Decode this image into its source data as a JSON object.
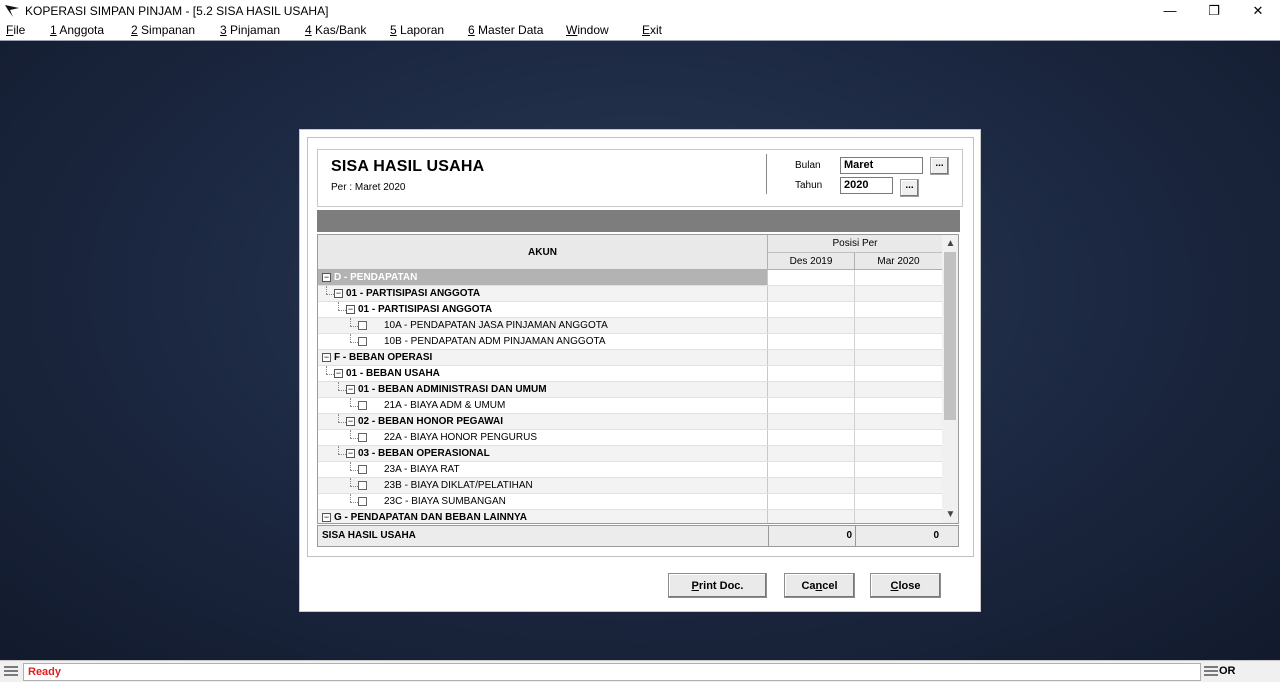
{
  "window": {
    "title": "KOPERASI SIMPAN PINJAM - [5.2 SISA HASIL USAHA]",
    "minimize": "—",
    "restore": "❐",
    "close": "✕"
  },
  "menu": [
    {
      "key": "F",
      "rest": "ile"
    },
    {
      "key": "1",
      "rest": " Anggota"
    },
    {
      "key": "2",
      "rest": " Simpanan"
    },
    {
      "key": "3",
      "rest": " Pinjaman"
    },
    {
      "key": "4",
      "rest": " Kas/Bank"
    },
    {
      "key": "5",
      "rest": " Laporan"
    },
    {
      "key": "6",
      "rest": " Master Data"
    },
    {
      "key": "W",
      "rest": "indow"
    },
    {
      "key": "E",
      "rest": "xit"
    }
  ],
  "report": {
    "title": "SISA HASIL USAHA",
    "subtitle": "Per : Maret 2020",
    "bulan_label": "Bulan",
    "bulan_value": "Maret",
    "tahun_label": "Tahun",
    "tahun_value": "2020",
    "picker_label": "..."
  },
  "grid": {
    "col_akun": "AKUN",
    "col_posisi": "Posisi Per",
    "col_des": "Des 2019",
    "col_mar": "Mar 2020",
    "rows": [
      {
        "text": "D - PENDAPATAN",
        "level": 0,
        "bold": true,
        "type": "node",
        "selected": true
      },
      {
        "text": "01 - PARTISIPASI ANGGOTA",
        "level": 1,
        "bold": true,
        "type": "node"
      },
      {
        "text": "01 - PARTISIPASI ANGGOTA",
        "level": 2,
        "bold": true,
        "type": "node"
      },
      {
        "text": "10A - PENDAPATAN JASA PINJAMAN ANGGOTA",
        "level": 3,
        "bold": false,
        "type": "leaf"
      },
      {
        "text": "10B - PENDAPATAN ADM PINJAMAN ANGGOTA",
        "level": 3,
        "bold": false,
        "type": "leaf"
      },
      {
        "text": "F - BEBAN OPERASI",
        "level": 0,
        "bold": true,
        "type": "node"
      },
      {
        "text": "01 - BEBAN USAHA",
        "level": 1,
        "bold": true,
        "type": "node"
      },
      {
        "text": "01 - BEBAN ADMINISTRASI DAN UMUM",
        "level": 2,
        "bold": true,
        "type": "node"
      },
      {
        "text": "21A - BIAYA ADM & UMUM",
        "level": 3,
        "bold": false,
        "type": "leaf"
      },
      {
        "text": "02 - BEBAN HONOR PEGAWAI",
        "level": 2,
        "bold": true,
        "type": "node"
      },
      {
        "text": "22A - BIAYA HONOR PENGURUS",
        "level": 3,
        "bold": false,
        "type": "leaf"
      },
      {
        "text": "03 - BEBAN OPERASIONAL",
        "level": 2,
        "bold": true,
        "type": "node"
      },
      {
        "text": "23A - BIAYA RAT",
        "level": 3,
        "bold": false,
        "type": "leaf"
      },
      {
        "text": "23B - BIAYA DIKLAT/PELATIHAN",
        "level": 3,
        "bold": false,
        "type": "leaf"
      },
      {
        "text": "23C - BIAYA SUMBANGAN",
        "level": 3,
        "bold": false,
        "type": "leaf"
      },
      {
        "text": "G - PENDAPATAN DAN BEBAN LAINNYA",
        "level": 0,
        "bold": true,
        "type": "node"
      }
    ],
    "scroll_up": "▲",
    "scroll_down": "▼"
  },
  "total": {
    "label": "SISA HASIL USAHA",
    "des": "0",
    "mar": "0"
  },
  "buttons": {
    "print_key": "P",
    "print_rest": "rint Doc.",
    "cancel_pre": "Ca",
    "cancel_key": "n",
    "cancel_rest": "cel",
    "close_key": "C",
    "close_rest": "lose"
  },
  "status": {
    "text": "Ready",
    "right": "OR"
  }
}
